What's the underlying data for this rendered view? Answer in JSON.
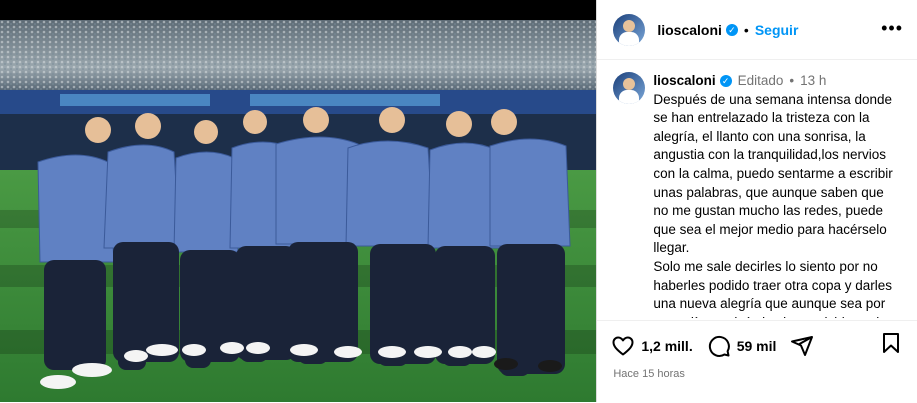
{
  "header": {
    "username": "lioscaloni",
    "follow_label": "Seguir",
    "separator": "•"
  },
  "caption": {
    "username": "lioscaloni",
    "edited_label": "Editado",
    "separator": "•",
    "time": "13 h",
    "paragraph1": "Después de una semana intensa donde\nse han entrelazado la tristeza con la\nalegría, el llanto con una sonrisa, la\nangustia con la tranquilidad,los nervios\ncon la calma, puedo sentarme a escribir\nunas palabras, que aunque saben que\nno me gustan mucho las redes, puede\nque sea el mejor medio para hacérselo\nllegar.",
    "paragraph2": "Solo me sale decirles lo siento por no\nhaberles podido traer otra copa y darles\nuna nueva alegría que aunque sea por\nunos días, quizás les haga olvidar todo"
  },
  "actions": {
    "likes": "1,2 mill.",
    "comments": "59 mil"
  },
  "posted": "Hace 15 horas",
  "colors": {
    "link_blue": "#0095f6",
    "muted_gray": "#737373",
    "jersey_blue": "#5b7fc0",
    "pitch_green": "#3a8a3a"
  },
  "icons": [
    "verified-icon",
    "more-options-icon",
    "heart-icon",
    "comment-icon",
    "share-icon",
    "bookmark-icon"
  ]
}
